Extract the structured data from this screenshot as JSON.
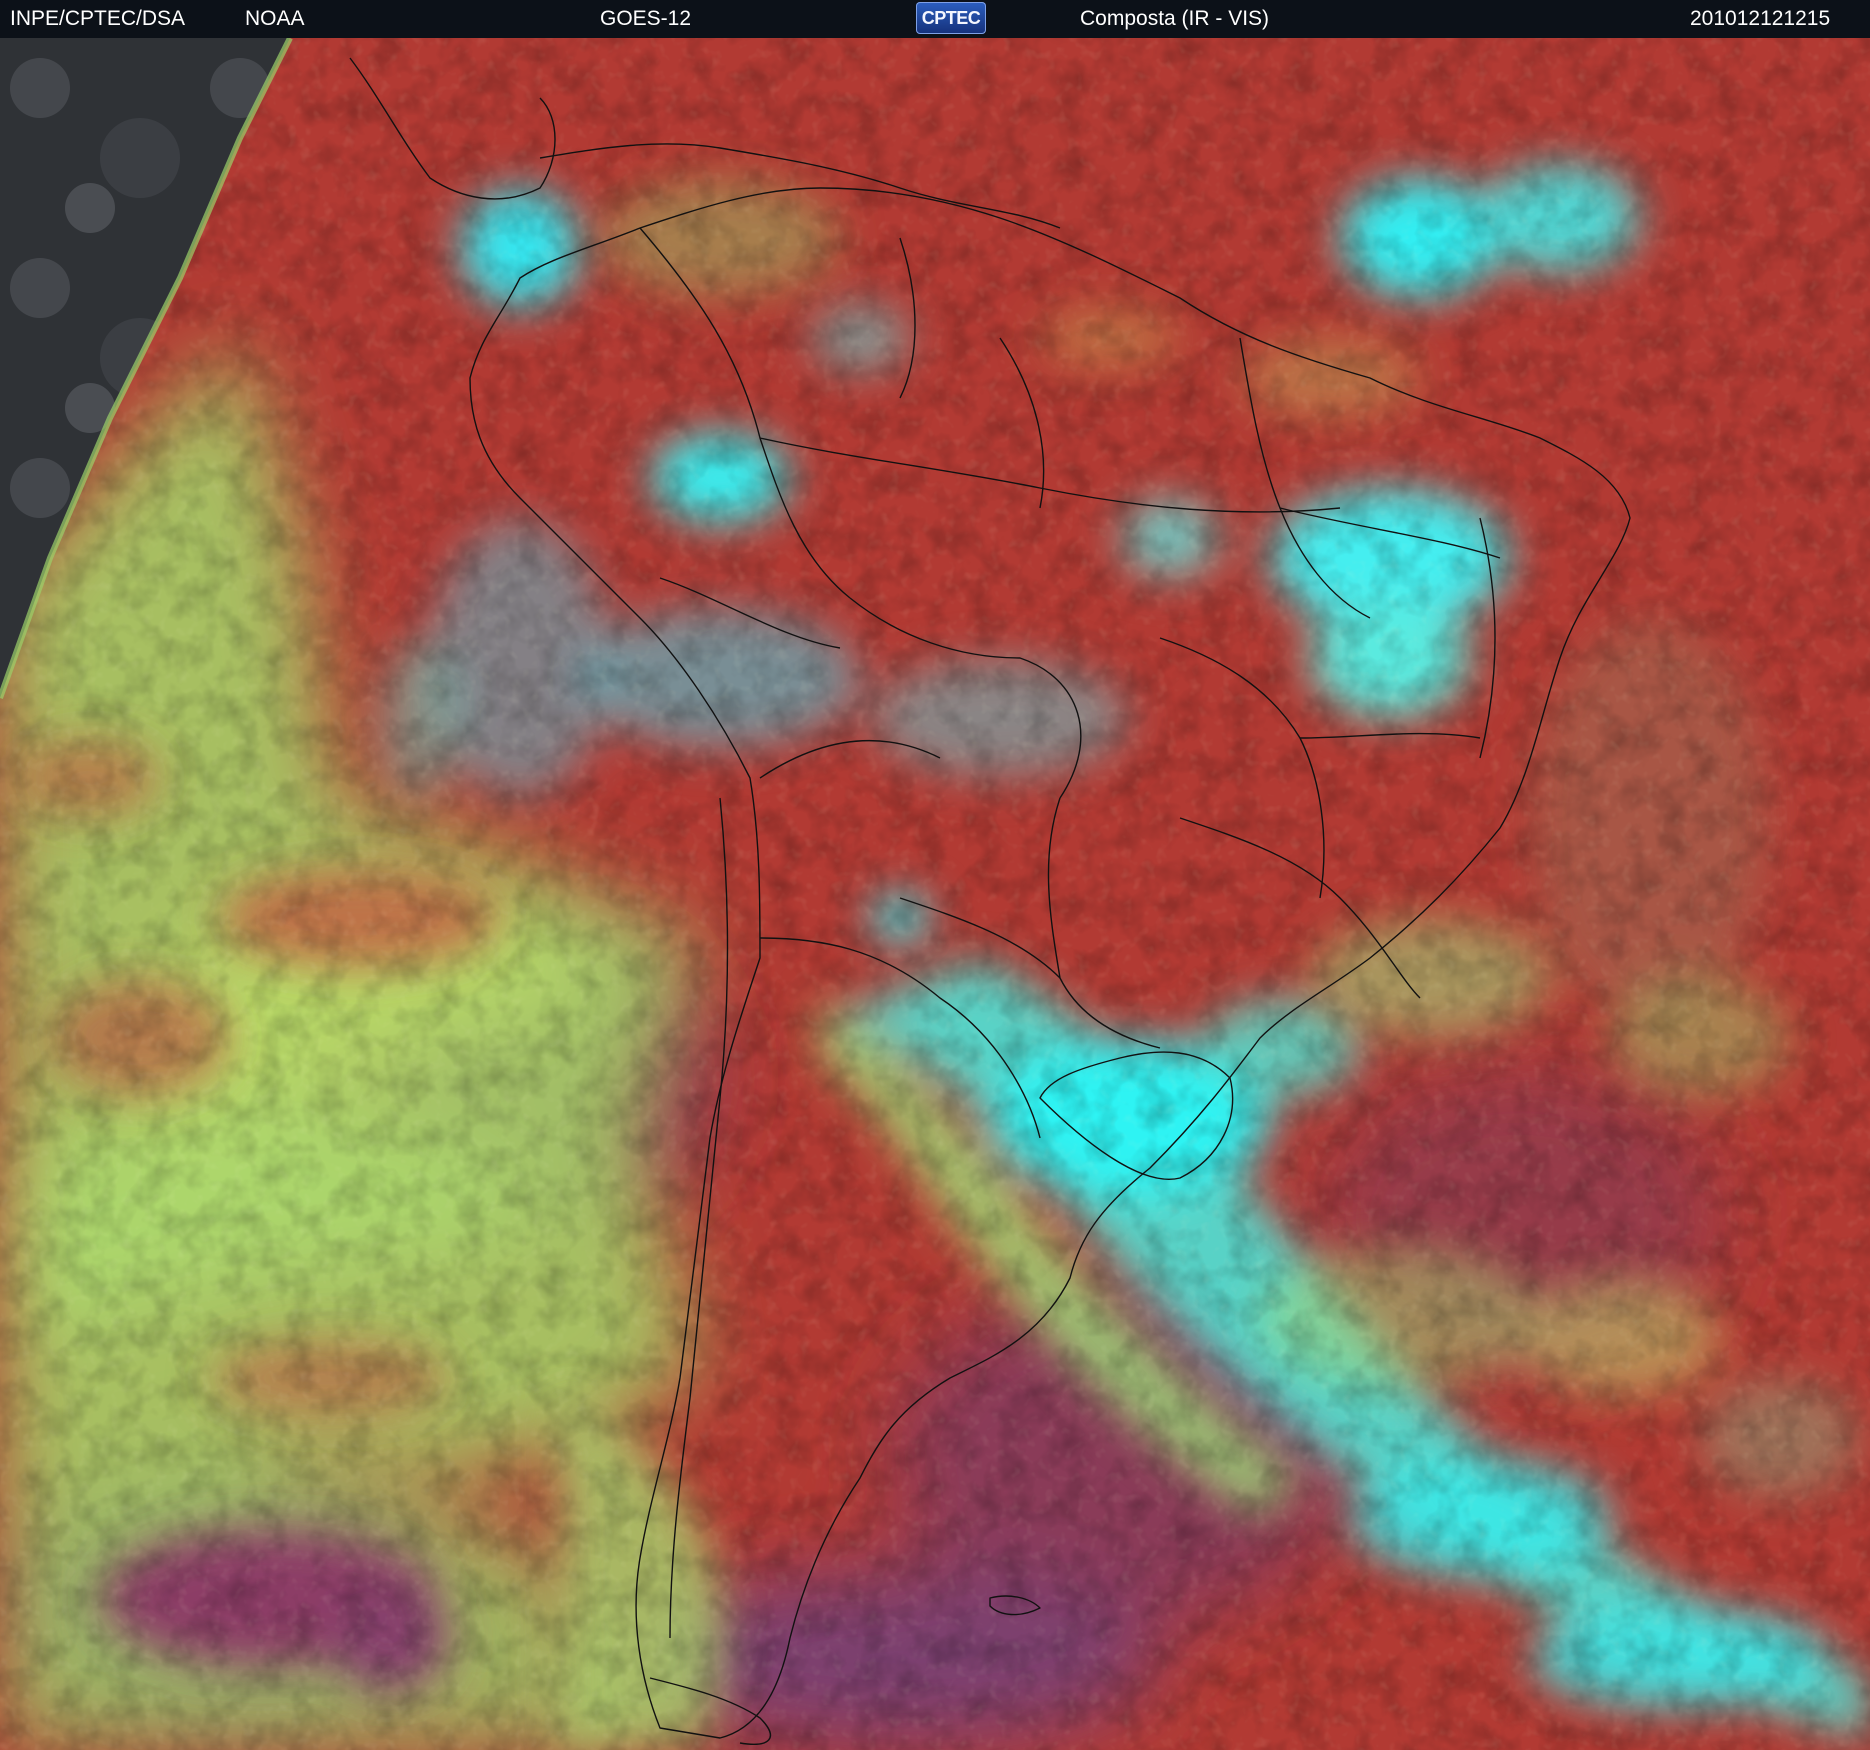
{
  "header": {
    "agency": "INPE/CPTEC/DSA",
    "source": "NOAA",
    "satellite": "GOES-12",
    "logo_text": "CPTEC",
    "product": "Composta (IR - VIS)",
    "timestamp": "201012121215"
  },
  "colors": {
    "clear_land_ocean_warm": "#b23a33",
    "cold_ocean": "#8a3a58",
    "low_cloud": "#9fe06a",
    "high_cloud": "#2ff0f0",
    "mid_cloud": "#6ab0a0",
    "no_data": "#2a2c30",
    "borders": "#111111"
  },
  "map": {
    "region": "South America",
    "icons": [
      "country-borders",
      "state-borders"
    ]
  }
}
